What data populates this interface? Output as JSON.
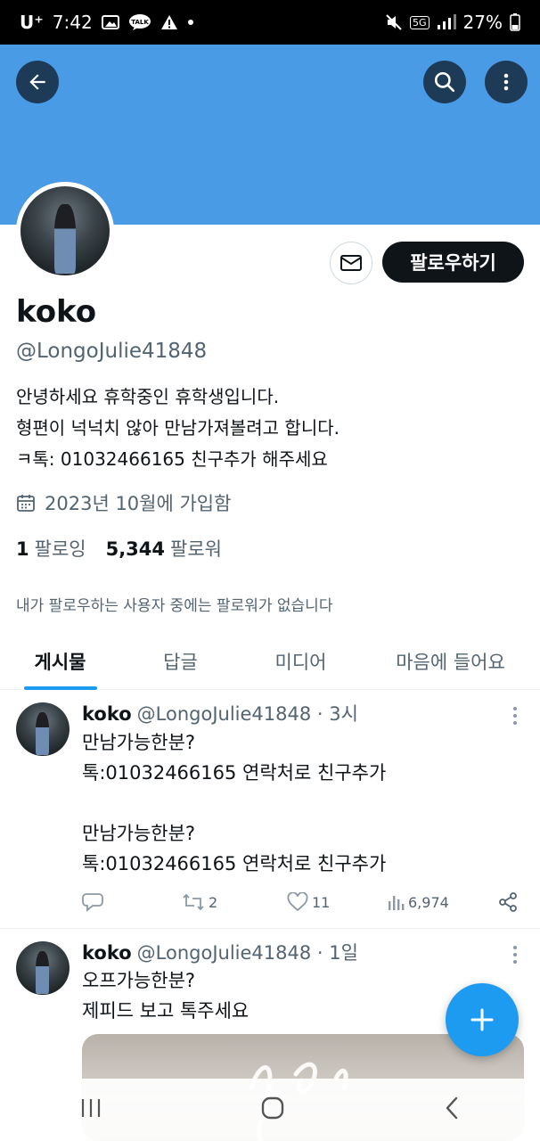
{
  "status_bar": {
    "carrier": "U⁺",
    "time": "7:42",
    "talk_label": "TALK",
    "network": "5G",
    "battery": "27%"
  },
  "profile": {
    "display_name": "koko",
    "handle": "@LongoJulie41848",
    "bio": "안녕하세요 휴학중인 휴학생입니다.\n형편이 넉넉치 않아 만남가져볼려고 합니다.\nㅋ톡: 01032466165 친구추가 해주세요",
    "joined": "2023년 10월에 가입함",
    "following_count": "1",
    "following_label": "팔로잉",
    "followers_count": "5,344",
    "followers_label": "팔로워",
    "mutual_note": "내가 팔로우하는 사용자 중에는 팔로워가 없습니다",
    "follow_button": "팔로우하기"
  },
  "tabs": [
    {
      "label": "게시물",
      "active": true
    },
    {
      "label": "답글",
      "active": false
    },
    {
      "label": "미디어",
      "active": false
    },
    {
      "label": "마음에 들어요",
      "active": false
    }
  ],
  "tweets": [
    {
      "name": "koko",
      "handle": "@LongoJulie41848",
      "sep": "·",
      "time": "3시",
      "text": "만남가능한분?\n톡:01032466165 연락처로 친구추가\n\n만남가능한분?\n톡:01032466165 연락처로 친구추가",
      "reposts": "2",
      "likes": "11",
      "views": "6,974"
    },
    {
      "name": "koko",
      "handle": "@LongoJulie41848",
      "sep": "·",
      "time": "1일",
      "text": "오프가능한분?\n제피드 보고 톡주세요"
    }
  ],
  "colors": {
    "banner": "#4a9be6",
    "accent": "#1d9bf0",
    "follow_button": "#0f1419"
  }
}
